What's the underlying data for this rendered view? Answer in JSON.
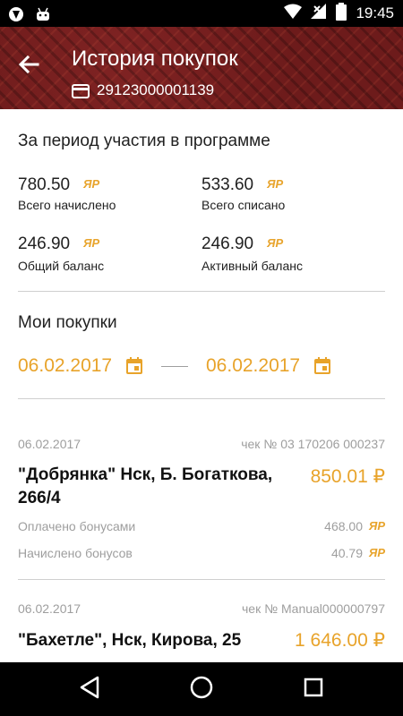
{
  "status_bar": {
    "time": "19:45"
  },
  "header": {
    "title": "История покупок",
    "card_number": "29123000001139"
  },
  "summary": {
    "title": "За период участия в программе",
    "accrued_total": {
      "value": "780.50",
      "label": "Всего начислено"
    },
    "written_off_total": {
      "value": "533.60",
      "label": "Всего списано"
    },
    "total_balance": {
      "value": "246.90",
      "label": "Общий баланс"
    },
    "active_balance": {
      "value": "246.90",
      "label": "Активный баланс"
    },
    "currency_symbol": "ЯР"
  },
  "purchases": {
    "title": "Мои покупки",
    "date_from": "06.02.2017",
    "date_to": "06.02.2017",
    "items": [
      {
        "date": "06.02.2017",
        "check": "чек № 03 170206 000237",
        "store": "\"Добрянка\" Нск, Б. Богаткова, 266/4",
        "amount": "850.01 ₽",
        "paid_label": "Оплачено бонусами",
        "paid_value": "468.00",
        "accrued_label": "Начислено бонусов",
        "accrued_value": "40.79"
      },
      {
        "date": "06.02.2017",
        "check": "чек № Manual000000797",
        "store": "\"Бахетле\", Нск, Кирова, 25",
        "amount": "1 646.00 ₽"
      }
    ]
  },
  "colors": {
    "accent": "#e8a32a",
    "header": "#6d1b1b",
    "divider": "#cfcfcf"
  }
}
